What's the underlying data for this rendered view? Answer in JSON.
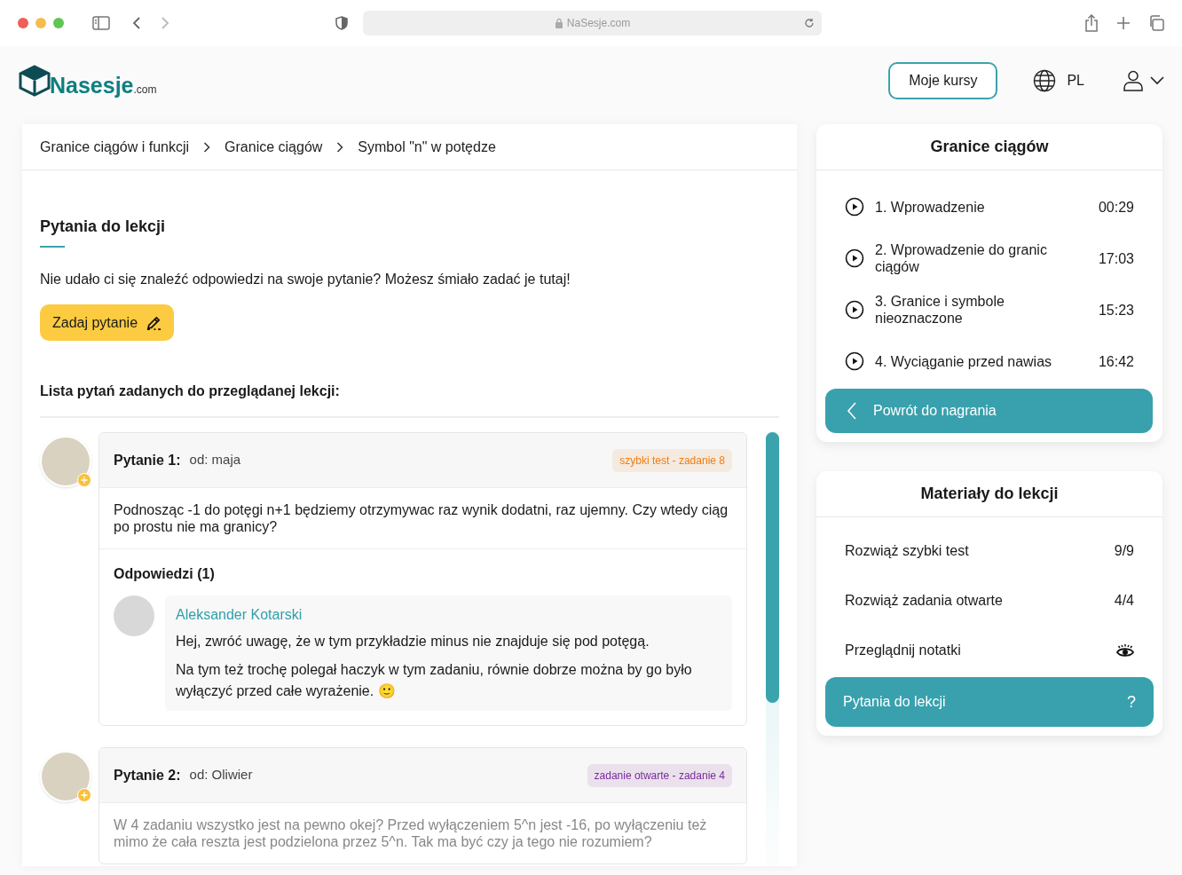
{
  "browser": {
    "url": "NaSesje.com"
  },
  "header": {
    "logo": "Nasesje",
    "logo_suffix": ".com",
    "courses_button": "Moje kursy",
    "language": "PL"
  },
  "breadcrumbs": [
    "Granice ciągów i funkcji",
    "Granice ciągów",
    "Symbol \"n\" w potędze"
  ],
  "questions_section": {
    "title": "Pytania do lekcji",
    "intro": "Nie udało ci się znaleźć odpowiedzi na swoje pytanie? Możesz śmiało zadać je tutaj!",
    "ask_button": "Zadaj pytanie",
    "list_title": "Lista pytań zadanych do przeglądanej lekcji:"
  },
  "questions": [
    {
      "label": "Pytanie 1:",
      "author": "od: maja",
      "tag": "szybki test - zadanie 8",
      "color": "#f07c12",
      "text": "Podnosząc -1 do potęgi n+1 będziemy otrzymywac raz wynik dodatni, raz ujemny. Czy wtedy ciąg po prostu nie ma granicy?",
      "answers_title": "Odpowiedzi (1)",
      "answers": [
        {
          "author": "Aleksander Kotarski",
          "paragraphs": [
            "Hej, zwróć uwagę, że w tym przykładzie minus nie znajduje się pod potęgą.",
            "Na tym też trochę polegał haczyk w tym zadaniu, równie dobrze można by go było wyłączyć przed całe wyrażenie. 🙂"
          ]
        }
      ]
    },
    {
      "label": "Pytanie 2:",
      "author": "od: Oliwier",
      "tag": "zadanie otwarte - zadanie 4",
      "color": "#7b2a9a",
      "text": "W 4 zadaniu wszystko jest na pewno okej? Przed wyłączeniem 5^n jest -16, po wyłączeniu też mimo że cała reszta jest podzielona przez 5^n. Tak ma być czy ja tego nie rozumiem?"
    }
  ],
  "lessons": {
    "title": "Granice ciągów",
    "items": [
      {
        "title": "1. Wprowadzenie",
        "duration": "00:29"
      },
      {
        "title": "2. Wprowadzenie do granic ciągów",
        "duration": "17:03"
      },
      {
        "title": "3. Granice i symbole nieoznaczone",
        "duration": "15:23"
      },
      {
        "title": "4. Wyciąganie przed nawias",
        "duration": "16:42"
      }
    ],
    "back_button": "Powrót do nagrania"
  },
  "materials": {
    "title": "Materiały do lekcji",
    "items": [
      {
        "label": "Rozwiąż szybki test",
        "kind": "count",
        "trailing": "9/9",
        "selected": false
      },
      {
        "label": "Rozwiąż zadania otwarte",
        "kind": "count",
        "trailing": "4/4",
        "selected": false
      },
      {
        "label": "Przeglądnij notatki",
        "kind": "eye",
        "selected": false
      },
      {
        "label": "Pytania do lekcji",
        "kind": "count",
        "trailing": "?",
        "selected": true
      }
    ]
  }
}
